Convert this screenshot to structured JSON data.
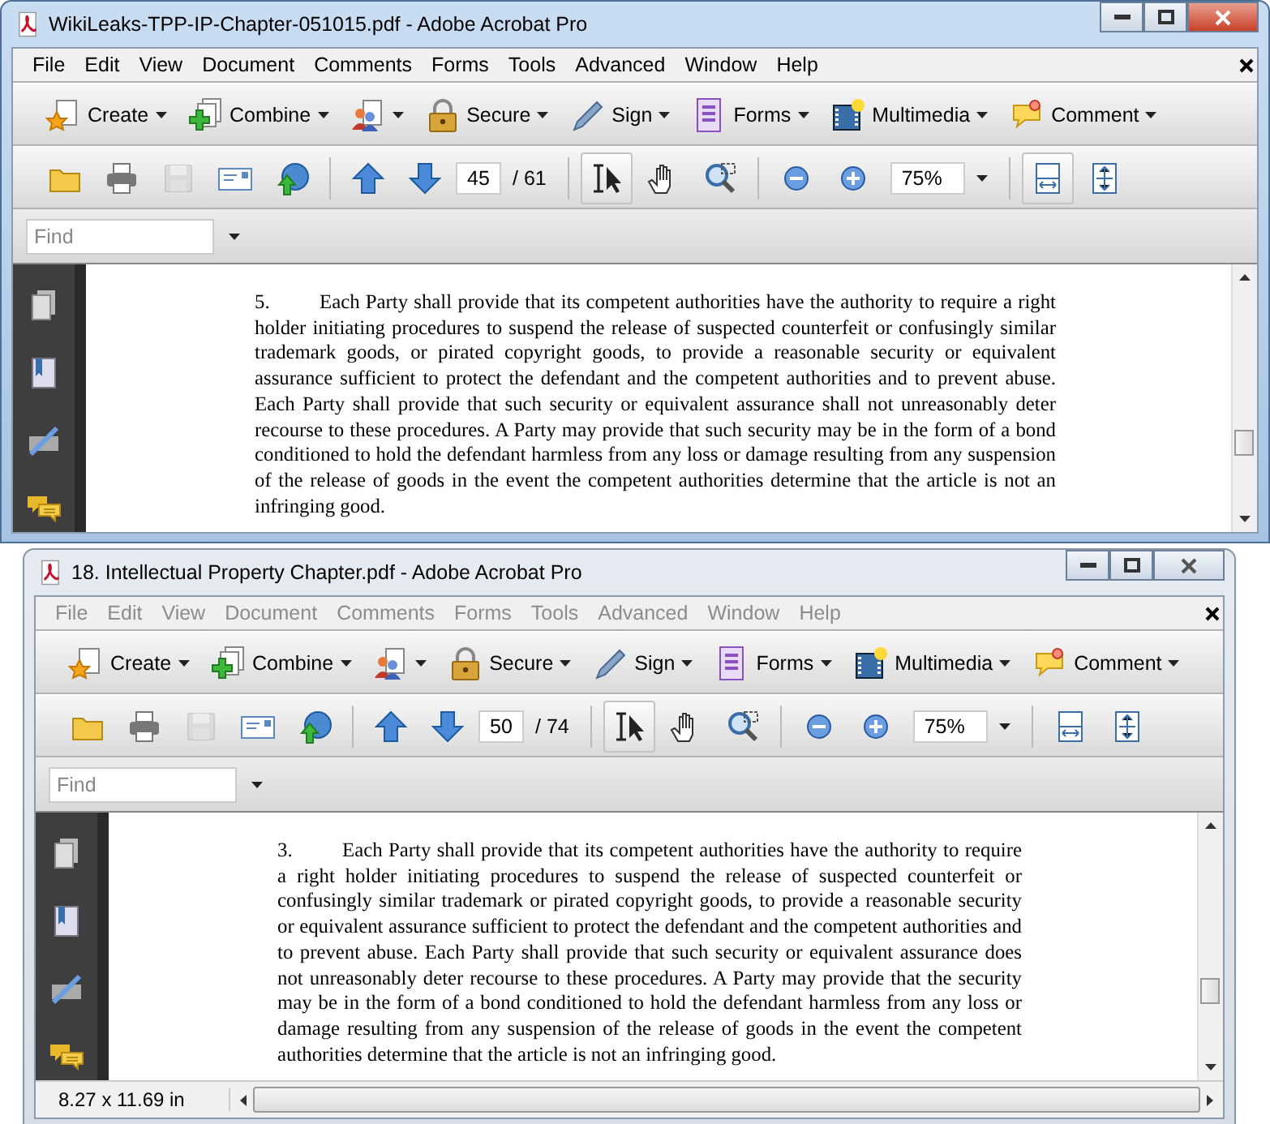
{
  "windows": [
    {
      "title": "WikiLeaks-TPP-IP-Chapter-051015.pdf - Adobe Acrobat Pro",
      "active": true,
      "menu": [
        "File",
        "Edit",
        "View",
        "Document",
        "Comments",
        "Forms",
        "Tools",
        "Advanced",
        "Window",
        "Help"
      ],
      "tasks": [
        {
          "kind": "create",
          "label": "Create"
        },
        {
          "kind": "combine",
          "label": "Combine"
        },
        {
          "kind": "share"
        },
        {
          "kind": "secure",
          "label": "Secure"
        },
        {
          "kind": "sign",
          "label": "Sign"
        },
        {
          "kind": "forms",
          "label": "Forms"
        },
        {
          "kind": "multimedia",
          "label": "Multimedia"
        },
        {
          "kind": "comment",
          "label": "Comment"
        }
      ],
      "tools": [
        {
          "kind": "open",
          "selected": false,
          "disabled": false
        },
        {
          "kind": "print",
          "selected": false,
          "disabled": false
        },
        {
          "kind": "save",
          "selected": false,
          "disabled": true
        },
        {
          "kind": "email",
          "selected": false,
          "disabled": false
        },
        {
          "kind": "upload",
          "selected": false,
          "disabled": false
        },
        {
          "kind": "sep"
        },
        {
          "kind": "prev",
          "selected": false,
          "disabled": false
        },
        {
          "kind": "next",
          "selected": false,
          "disabled": false
        },
        {
          "kind": "page"
        },
        {
          "kind": "sep"
        },
        {
          "kind": "select",
          "selected": true,
          "disabled": false
        },
        {
          "kind": "hand",
          "selected": false,
          "disabled": false
        },
        {
          "kind": "marquee",
          "selected": false,
          "disabled": false
        },
        {
          "kind": "sep"
        },
        {
          "kind": "zoomout",
          "selected": false,
          "disabled": false
        },
        {
          "kind": "zoomin",
          "selected": false,
          "disabled": false
        },
        {
          "kind": "zoom"
        },
        {
          "kind": "sep"
        },
        {
          "kind": "fitwidth",
          "selected": true,
          "disabled": false
        },
        {
          "kind": "fitpage",
          "selected": false,
          "disabled": false
        }
      ],
      "page": "45",
      "page_total": "/ 61",
      "zoom": "75%",
      "find_placeholder": "Find",
      "paragraph": {
        "number": "5.",
        "text": "Each Party shall provide that its competent authorities have the authority to require a right holder initiating procedures to suspend the release of suspected counterfeit or confusingly similar trademark goods, or pirated copyright goods, to provide a reasonable security or equivalent assurance sufficient to protect the defendant and the competent authorities and to prevent abuse. Each Party shall provide that such security or equivalent assurance shall not unreasonably deter recourse to these procedures. A Party may provide that such security may be in the form of a bond conditioned to hold the defendant harmless from any loss or damage resulting from any suspension of the release of goods in the event the competent authorities determine that the article is not an infringing good."
      }
    },
    {
      "title": "18. Intellectual Property Chapter.pdf - Adobe Acrobat Pro",
      "active": false,
      "menu": [
        "File",
        "Edit",
        "View",
        "Document",
        "Comments",
        "Forms",
        "Tools",
        "Advanced",
        "Window",
        "Help"
      ],
      "tasks": [
        {
          "kind": "create",
          "label": "Create"
        },
        {
          "kind": "combine",
          "label": "Combine"
        },
        {
          "kind": "share"
        },
        {
          "kind": "secure",
          "label": "Secure"
        },
        {
          "kind": "sign",
          "label": "Sign"
        },
        {
          "kind": "forms",
          "label": "Forms"
        },
        {
          "kind": "multimedia",
          "label": "Multimedia"
        },
        {
          "kind": "comment",
          "label": "Comment"
        }
      ],
      "tools": [
        {
          "kind": "open",
          "selected": false,
          "disabled": false
        },
        {
          "kind": "print",
          "selected": false,
          "disabled": false
        },
        {
          "kind": "save",
          "selected": false,
          "disabled": true
        },
        {
          "kind": "email",
          "selected": false,
          "disabled": false
        },
        {
          "kind": "upload",
          "selected": false,
          "disabled": false
        },
        {
          "kind": "sep"
        },
        {
          "kind": "prev",
          "selected": false,
          "disabled": false
        },
        {
          "kind": "next",
          "selected": false,
          "disabled": false
        },
        {
          "kind": "page"
        },
        {
          "kind": "sep"
        },
        {
          "kind": "select",
          "selected": true,
          "disabled": false
        },
        {
          "kind": "hand",
          "selected": false,
          "disabled": false
        },
        {
          "kind": "marquee",
          "selected": false,
          "disabled": false
        },
        {
          "kind": "sep"
        },
        {
          "kind": "zoomout",
          "selected": false,
          "disabled": false
        },
        {
          "kind": "zoomin",
          "selected": false,
          "disabled": false
        },
        {
          "kind": "zoom"
        },
        {
          "kind": "sep"
        },
        {
          "kind": "fitwidth",
          "selected": false,
          "disabled": false
        },
        {
          "kind": "fitpage",
          "selected": false,
          "disabled": false
        }
      ],
      "page": "50",
      "page_total": "/ 74",
      "zoom": "75%",
      "find_placeholder": "Find",
      "paragraph": {
        "number": "3.",
        "text": "Each Party shall provide that its competent authorities have the authority to require a right holder initiating procedures to suspend the release of suspected counterfeit or confusingly similar trademark or pirated copyright goods, to provide a reasonable security or equivalent assurance sufficient to protect the defendant and the competent authorities and to prevent abuse.  Each Party shall provide that such security or equivalent assurance does not unreasonably deter recourse to these procedures.  A Party may provide that the security may be in the form of a bond conditioned to hold the defendant harmless from any loss or damage resulting from any suspension of the release of goods in the event the competent authorities determine that the article is not an infringing good."
      },
      "page_size": "8.27 x 11.69 in"
    }
  ]
}
